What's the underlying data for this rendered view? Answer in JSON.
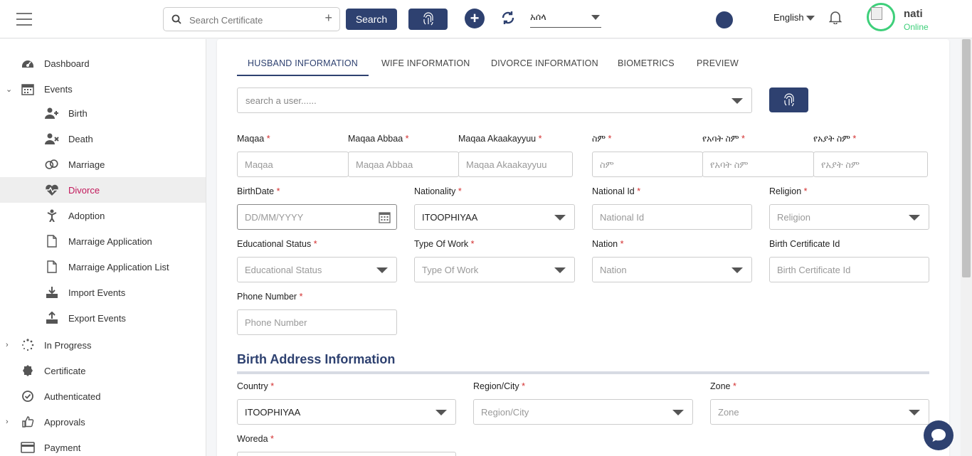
{
  "topbar": {
    "search_placeholder": "Search Certificate",
    "search_button": "Search",
    "org_select": "አሰላ",
    "language": "English",
    "user_name": "nati",
    "user_status": "Online"
  },
  "colors": {
    "primary": "#2e4170",
    "active_nav": "#c2185b",
    "online": "#3ecf7a",
    "required": "#d32f2f"
  },
  "sidebar": {
    "items": [
      {
        "label": "Dashboard",
        "icon": "dashboard-icon"
      },
      {
        "label": "Events",
        "icon": "calendar-icon"
      },
      {
        "label": "Birth",
        "icon": "user-plus-icon"
      },
      {
        "label": "Death",
        "icon": "user-x-icon"
      },
      {
        "label": "Marriage",
        "icon": "rings-icon"
      },
      {
        "label": "Divorce",
        "icon": "heartbeat-icon"
      },
      {
        "label": "Adoption",
        "icon": "child-icon"
      },
      {
        "label": "Marraige Application",
        "icon": "document-icon"
      },
      {
        "label": "Marraige Application List",
        "icon": "document-icon"
      },
      {
        "label": "Import Events",
        "icon": "import-icon"
      },
      {
        "label": "Export Events",
        "icon": "export-icon"
      },
      {
        "label": "In Progress",
        "icon": "spinner-icon"
      },
      {
        "label": "Certificate",
        "icon": "certificate-icon"
      },
      {
        "label": "Authenticated",
        "icon": "check-circle-icon"
      },
      {
        "label": "Approvals",
        "icon": "thumbs-up-icon"
      },
      {
        "label": "Payment",
        "icon": "card-icon"
      }
    ]
  },
  "tabs": [
    "HUSBAND INFORMATION",
    "WIFE INFORMATION",
    "DIVORCE INFORMATION",
    "BIOMETRICS",
    "PREVIEW"
  ],
  "user_search_placeholder": "search a user......",
  "form": {
    "maqaa": {
      "label": "Maqaa",
      "placeholder": "Maqaa"
    },
    "maqaa_abbaa": {
      "label": "Maqaa Abbaa",
      "placeholder": "Maqaa Abbaa"
    },
    "maqaa_akaakayyuu": {
      "label": "Maqaa Akaakayyuu",
      "placeholder": "Maqaa Akaakayyuu"
    },
    "sim": {
      "label": "ስም",
      "placeholder": "ስም"
    },
    "father_name": {
      "label": "የአባት ስም",
      "placeholder": "የአባት ስም"
    },
    "grandfather_name": {
      "label": "የአያት ስም",
      "placeholder": "የአያት ስም"
    },
    "birth_date": {
      "label": "BirthDate",
      "placeholder": "DD/MM/YYYY"
    },
    "nationality": {
      "label": "Nationality",
      "value": "ITOOPHIYAA"
    },
    "national_id": {
      "label": "National Id",
      "placeholder": "National Id"
    },
    "religion": {
      "label": "Religion",
      "placeholder": "Religion"
    },
    "educational_status": {
      "label": "Educational Status",
      "placeholder": "Educational Status"
    },
    "type_of_work": {
      "label": "Type Of Work",
      "placeholder": "Type Of Work"
    },
    "nation": {
      "label": "Nation",
      "placeholder": "Nation"
    },
    "birth_certificate_id": {
      "label": "Birth Certificate Id",
      "placeholder": "Birth Certificate Id"
    },
    "phone_number": {
      "label": "Phone Number",
      "placeholder": "Phone Number"
    }
  },
  "birth_address": {
    "title": "Birth Address Information",
    "country": {
      "label": "Country",
      "value": "ITOOPHIYAA"
    },
    "region": {
      "label": "Region/City",
      "placeholder": "Region/City"
    },
    "zone": {
      "label": "Zone",
      "placeholder": "Zone"
    },
    "woreda": {
      "label": "Woreda"
    }
  },
  "required_mark": "*"
}
